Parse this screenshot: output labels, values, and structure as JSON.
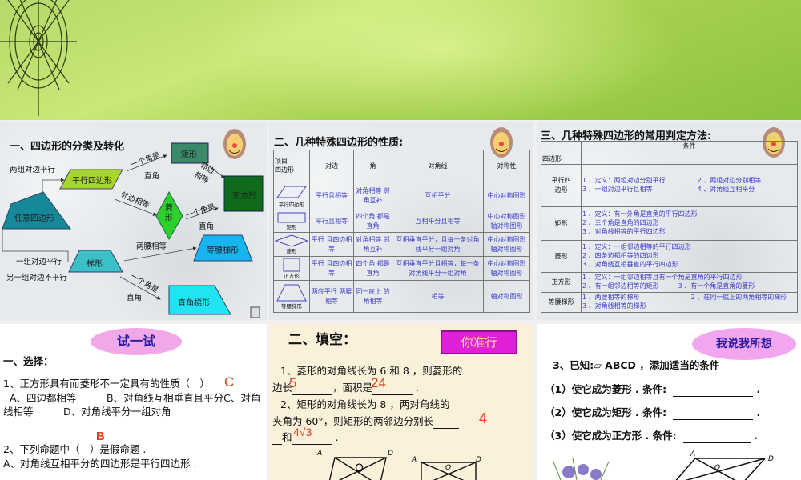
{
  "panel1": {
    "title": "一、四边形的分类及转化",
    "shapes": {
      "rectangle": "矩形",
      "square": "正方形",
      "parallelogram": "平行四边形",
      "quadrilateral": "任意四边形",
      "rhombus": "菱形",
      "isosceles_trapezoid": "等腰梯形",
      "trapezoid": "梯形",
      "right_trapezoid": "直角梯形"
    },
    "labels": {
      "two_pairs_parallel": "两组对边平行",
      "one_angle_1": "一个角是",
      "right_1": "直角",
      "adjacent_equal_1": "邻边相等",
      "adjacent_equal_2": "邻边相等",
      "one_angle_2": "一个角是",
      "right_2": "直角",
      "legs_equal": "两腰相等",
      "one_pair_parallel": "一组对边平行",
      "other_not_parallel": "另一组对边不平行",
      "one_angle_3": "一个角是",
      "right_3": "直角"
    }
  },
  "panel2": {
    "title": "二、几种特殊四边形的性质:",
    "header": {
      "item": "项目",
      "quad": "四边形",
      "sides": "对边",
      "angles": "角",
      "diagonals": "对角线",
      "symmetry": "对称性"
    },
    "rows": [
      {
        "name": "平行四边形",
        "sides": "平行且相等",
        "angles": "对角相等 邻角互补",
        "diagonals": "互相平分",
        "symmetry": "中心对称图形"
      },
      {
        "name": "矩形",
        "sides": "平行且相等",
        "angles": "四个角 都是直角",
        "diagonals": "互相平分且相等",
        "symmetry": "中心对称图形 轴对称图形"
      },
      {
        "name": "菱形",
        "sides": "平行 且四边相等",
        "angles": "对角相等 邻角互补",
        "diagonals": "互相垂直平分，且每一条对角线平分一组对角",
        "symmetry": "中心对称图形 轴对称图形"
      },
      {
        "name": "正方形",
        "sides": "平行 且四边相等",
        "angles": "四个角 都是直角",
        "diagonals": "互相垂直平分且相等，每一条对角线平分一组对角",
        "symmetry": "中心对称图形 轴对称图形"
      },
      {
        "name": "等腰梯形",
        "sides": "两底平行 两腰相等",
        "angles": "同一底上 的角相等",
        "diagonals": "相等",
        "symmetry": "轴对称图形"
      }
    ]
  },
  "panel3": {
    "title": "三、几种特殊四边形的常用判定方法:",
    "header": {
      "quad": "四边形",
      "cond": "条件"
    },
    "rows": [
      {
        "name": "平行四边形",
        "cond": [
          "1 、定义：两组对边分别平行　　　　　2 、两组对边分别相等",
          "3 、一组对边平行且相等　　　　　　　4 、对角线互相平分"
        ]
      },
      {
        "name": "矩形",
        "cond": [
          "1 、定义：有一外角是直角的平行四边形",
          "2 、三个角是直角的四边形",
          "3 、对角线相等的平行四边形"
        ]
      },
      {
        "name": "菱形",
        "cond": [
          "1 、定义：一组邻边相等的平行四边形",
          "2 、四条边都相等的四边形",
          "3 、对角线互相垂直的平行四边形"
        ]
      },
      {
        "name": "正方形",
        "cond": [
          "1 、定义：一组邻边相等且有一个角是直角的平行四边形",
          "2 、有一组邻边相等的矩形　　　3 、有一个角是直角的菱形"
        ]
      },
      {
        "name": "等腰梯形",
        "cond": [
          "1 、两腰相等的梯形　　　　　　　　2 、在同一底上的两角相等的梯形　　　3 、对角线相等的梯形"
        ]
      }
    ]
  },
  "panel4": {
    "badge": "试一试",
    "heading": "一、选择：",
    "q1": "1、正方形具有而菱形不一定具有的性质（　）",
    "q1_answer": "C",
    "q1_options": "A、四边都相等　　　B、对角线互相垂直且平分C、对角线相等　　　D、对角线平分一组对角",
    "q2_answer": "B",
    "q2": "2、下列命题中（　）是假命题 .",
    "q2_a": "A、对角线互相平分的四边形是平行四边形 ."
  },
  "panel5": {
    "heading": "二、填空：",
    "badge": "你准行",
    "q1a": "1、菱形的对角线长为 6 和 8 ，则菱形的",
    "q1b_1": "边长",
    "q1b_2": "，面积是",
    "ans_side": "5",
    "ans_area": "24",
    "q2a": "2、矩形的对角线长为 8 ，两对角线的",
    "q2b": "夹角为 60°，则矩形的两邻边分别长",
    "ans_a": "4",
    "q2c": "和",
    "ans_b": "4√3",
    "fig_labels": {
      "A": "A",
      "D": "D",
      "O": "O"
    }
  },
  "panel6": {
    "badge": "我说我所想",
    "q3": "3、已知:▱ ABCD ，添加适当的条件",
    "c1": "（1）使它成为菱形 . 条件:",
    "c2": "（2）使它成为矩形 . 条件:",
    "c3": "（3）使它成为正方形 . 条件:",
    "fig_labels": {
      "A": "A",
      "D": "D",
      "O": "O"
    }
  }
}
